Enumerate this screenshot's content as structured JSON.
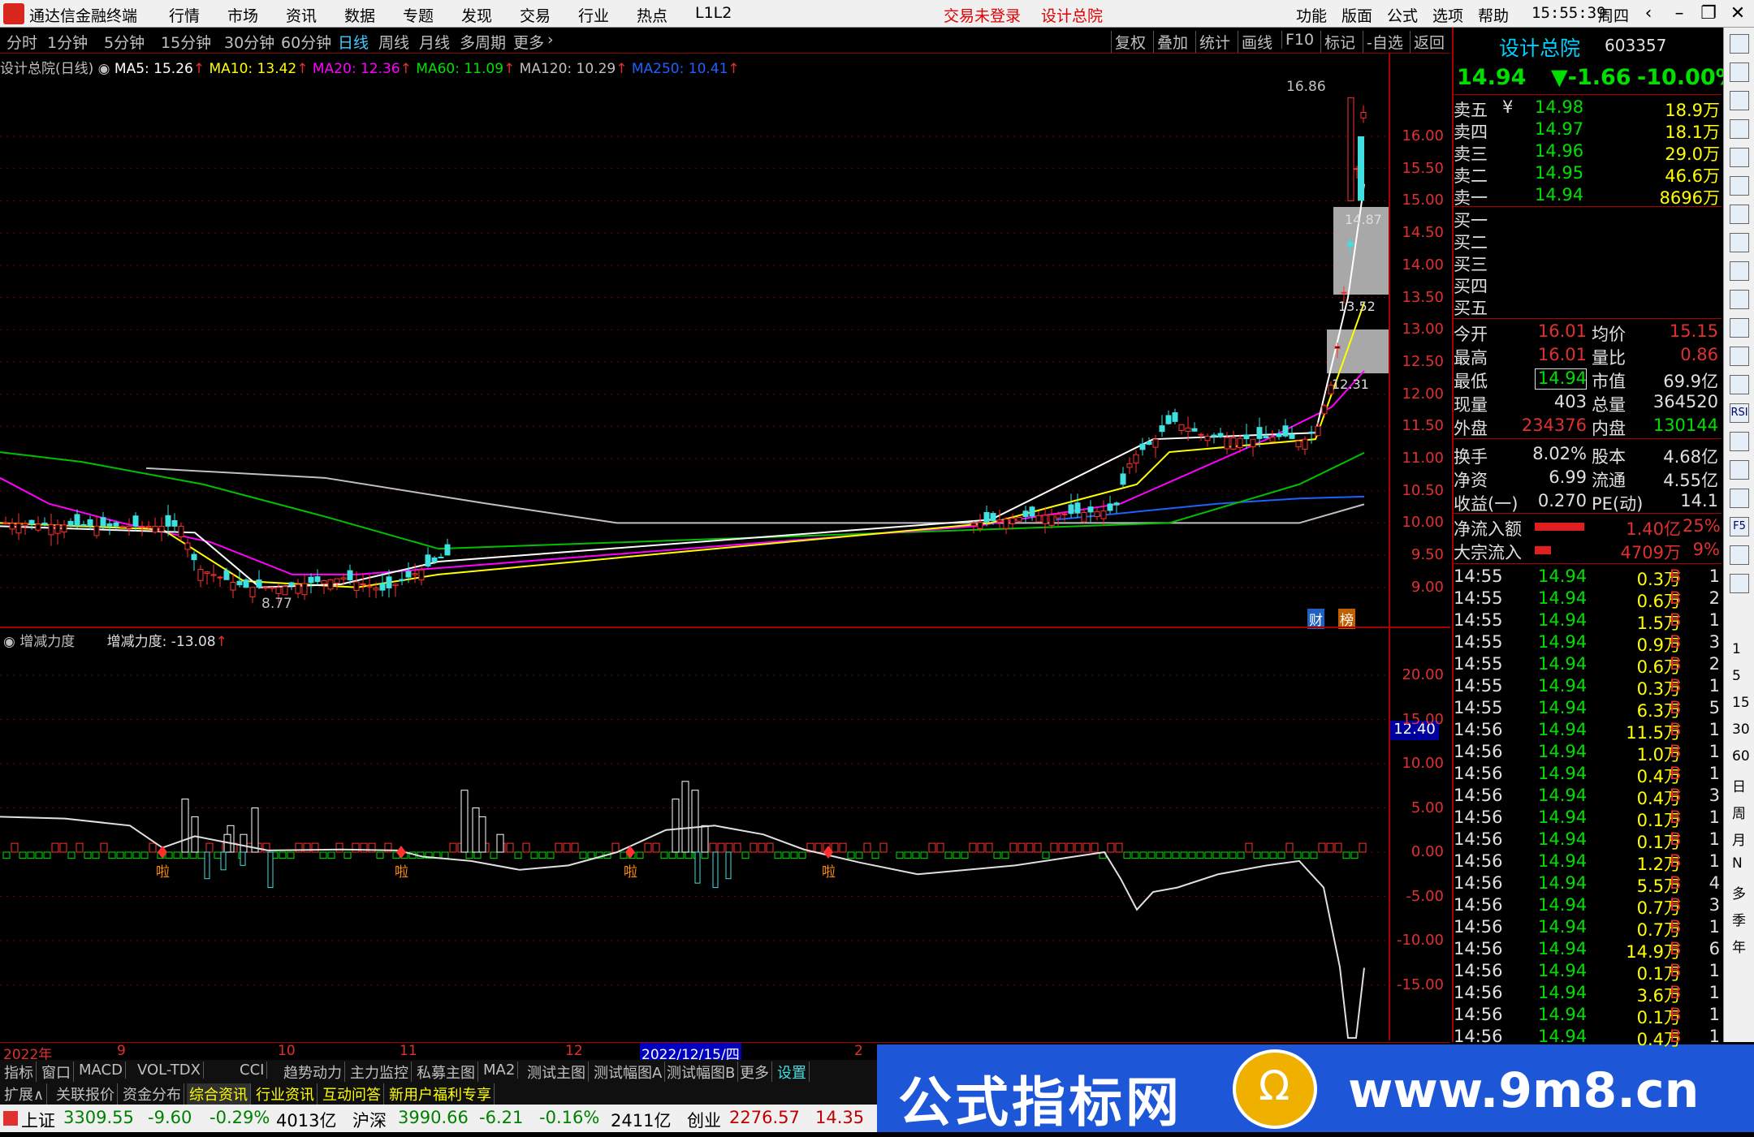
{
  "titlebar": {
    "app_title": "通达信金融终端",
    "menus": [
      "行情",
      "市场",
      "资讯",
      "数据",
      "专题",
      "发现",
      "交易",
      "行业",
      "热点",
      "L1L2"
    ],
    "trade_status": "交易未登录",
    "stock_name": "设计总院",
    "right_menus": [
      "功能",
      "版面",
      "公式",
      "选项",
      "帮助"
    ],
    "time": "15:55:39",
    "weekday": "周四"
  },
  "periods": [
    "分时",
    "1分钟",
    "5分钟",
    "15分钟",
    "30分钟",
    "60分钟",
    "日线",
    "周线",
    "月线",
    "多周期",
    "更多"
  ],
  "selected_period": "日线",
  "tools": [
    "复权",
    "叠加",
    "统计",
    "画线",
    "F10",
    "标记",
    "-自选",
    "返回"
  ],
  "main_chart": {
    "title": "设计总院(日线)",
    "ma": [
      {
        "label": "MA5: 15.26",
        "color": "#ffffff"
      },
      {
        "label": "MA10: 13.42",
        "color": "#ffff00"
      },
      {
        "label": "MA20: 12.36",
        "color": "#ff00ff"
      },
      {
        "label": "MA60: 11.09",
        "color": "#00e000"
      },
      {
        "label": "MA120: 10.29",
        "color": "#c0c0c0"
      },
      {
        "label": "MA250: 10.41",
        "color": "#2060ff"
      }
    ],
    "yticks": [
      "16.00",
      "15.50",
      "15.00",
      "14.50",
      "14.00",
      "13.50",
      "13.00",
      "12.50",
      "12.00",
      "11.50",
      "11.00",
      "10.50",
      "10.00",
      "9.50",
      "9.00"
    ],
    "high_label": "16.86",
    "low_label": "8.77",
    "box_labels": [
      "14.87",
      "13.52",
      "12.31"
    ],
    "badges": [
      "财",
      "榜"
    ]
  },
  "sub_chart": {
    "title": "增减力度",
    "value_label": "增减力度: -13.08",
    "yticks": [
      "20.00",
      "15.00",
      "10.00",
      "5.00",
      "0.00",
      "-5.00",
      "-10.00",
      "-15.00"
    ],
    "current_tag": "12.40",
    "marker_text": "啦"
  },
  "time_axis": [
    "2022年",
    "9",
    "10",
    "11",
    "12",
    "2022/12/15/四",
    "2"
  ],
  "quote": {
    "name": "设计总院",
    "code": "603357",
    "price": "14.94",
    "change": "▼-1.66",
    "change_pct": "-10.00%",
    "asks": [
      {
        "label": "卖五",
        "price": "14.98",
        "vol": "18.9万"
      },
      {
        "label": "卖四",
        "price": "14.97",
        "vol": "18.1万"
      },
      {
        "label": "卖三",
        "price": "14.96",
        "vol": "29.0万"
      },
      {
        "label": "卖二",
        "price": "14.95",
        "vol": "46.6万"
      },
      {
        "label": "卖一",
        "price": "14.94",
        "vol": "8696万"
      }
    ],
    "ask_extra": "¥",
    "bids": [
      "买一",
      "买二",
      "买三",
      "买四",
      "买五"
    ],
    "stats": [
      {
        "l1": "今开",
        "v1": "16.01",
        "l2": "均价",
        "v2": "15.15",
        "c1": "#e03030",
        "c2": "#e03030"
      },
      {
        "l1": "最高",
        "v1": "16.01",
        "l2": "量比",
        "v2": "0.86",
        "c1": "#e03030",
        "c2": "#e03030"
      },
      {
        "l1": "最低",
        "v1": "14.94",
        "l2": "市值",
        "v2": "69.9亿",
        "c1": "#00e000",
        "c2": "#e0e0e0"
      },
      {
        "l1": "现量",
        "v1": "403",
        "l2": "总量",
        "v2": "364520",
        "c1": "#e0e0e0",
        "c2": "#e0e0e0"
      },
      {
        "l1": "外盘",
        "v1": "234376",
        "l2": "内盘",
        "v2": "130144",
        "c1": "#e03030",
        "c2": "#00e000"
      },
      {
        "l1": "换手",
        "v1": "8.02%",
        "l2": "股本",
        "v2": "4.68亿",
        "c1": "#e0e0e0",
        "c2": "#e0e0e0"
      },
      {
        "l1": "净资",
        "v1": "6.99",
        "l2": "流通",
        "v2": "4.55亿",
        "c1": "#e0e0e0",
        "c2": "#e0e0e0"
      },
      {
        "l1": "收益(一)",
        "v1": "0.270",
        "l2": "PE(动)",
        "v2": "14.1",
        "c1": "#e0e0e0",
        "c2": "#e0e0e0"
      }
    ],
    "flows": [
      {
        "label": "净流入额",
        "value": "1.40亿",
        "pct": "25%",
        "bar": 0.9
      },
      {
        "label": "大宗流入",
        "value": "4709万",
        "pct": "9%",
        "bar": 0.3
      }
    ],
    "ticks": [
      {
        "t": "14:55",
        "p": "14.94",
        "v": "0.3万",
        "s": "B",
        "n": "1"
      },
      {
        "t": "14:55",
        "p": "14.94",
        "v": "0.6万",
        "s": "B",
        "n": "2"
      },
      {
        "t": "14:55",
        "p": "14.94",
        "v": "1.5万",
        "s": "B",
        "n": "1"
      },
      {
        "t": "14:55",
        "p": "14.94",
        "v": "0.9万",
        "s": "B",
        "n": "3"
      },
      {
        "t": "14:55",
        "p": "14.94",
        "v": "0.6万",
        "s": "B",
        "n": "2"
      },
      {
        "t": "14:55",
        "p": "14.94",
        "v": "0.3万",
        "s": "B",
        "n": "1"
      },
      {
        "t": "14:55",
        "p": "14.94",
        "v": "6.3万",
        "s": "B",
        "n": "5"
      },
      {
        "t": "14:56",
        "p": "14.94",
        "v": "11.5万",
        "s": "B",
        "n": "1"
      },
      {
        "t": "14:56",
        "p": "14.94",
        "v": "1.0万",
        "s": "B",
        "n": "1"
      },
      {
        "t": "14:56",
        "p": "14.94",
        "v": "0.4万",
        "s": "B",
        "n": "1"
      },
      {
        "t": "14:56",
        "p": "14.94",
        "v": "0.4万",
        "s": "B",
        "n": "3"
      },
      {
        "t": "14:56",
        "p": "14.94",
        "v": "0.1万",
        "s": "B",
        "n": "1"
      },
      {
        "t": "14:56",
        "p": "14.94",
        "v": "0.1万",
        "s": "B",
        "n": "1"
      },
      {
        "t": "14:56",
        "p": "14.94",
        "v": "1.2万",
        "s": "B",
        "n": "1"
      },
      {
        "t": "14:56",
        "p": "14.94",
        "v": "5.5万",
        "s": "B",
        "n": "4"
      },
      {
        "t": "14:56",
        "p": "14.94",
        "v": "0.7万",
        "s": "B",
        "n": "3"
      },
      {
        "t": "14:56",
        "p": "14.94",
        "v": "0.7万",
        "s": "B",
        "n": "1"
      },
      {
        "t": "14:56",
        "p": "14.94",
        "v": "14.9万",
        "s": "B",
        "n": "6"
      },
      {
        "t": "14:56",
        "p": "14.94",
        "v": "0.1万",
        "s": "B",
        "n": "1"
      },
      {
        "t": "14:56",
        "p": "14.94",
        "v": "3.6万",
        "s": "B",
        "n": "1"
      },
      {
        "t": "14:56",
        "p": "14.94",
        "v": "0.1万",
        "s": "B",
        "n": "1"
      },
      {
        "t": "14:56",
        "p": "14.94",
        "v": "0.4万",
        "s": "B",
        "n": "1"
      }
    ]
  },
  "sidebar_labels": [
    "1",
    "5",
    "15",
    "30",
    "60",
    "日",
    "周",
    "月",
    "N",
    "多",
    "季",
    "年"
  ],
  "sidebar_icons": [
    "RSI",
    "Fn",
    "F6",
    "F10",
    "F2",
    "F5"
  ],
  "indicator_tabs": [
    "指标",
    "窗口",
    "MACD",
    "VOL-TDX",
    "CCI",
    "趋势动力",
    "主力监控",
    "私募主图",
    "MA2",
    "测试主图",
    "测试幅图A",
    "测试幅图B",
    "更多",
    "设置"
  ],
  "extra_tabs": [
    "扩展∧",
    "关联报价",
    "资金分布",
    "综合资讯",
    "行业资讯",
    "互动问答",
    "新用户福利专享"
  ],
  "indices": [
    {
      "name": "上证",
      "value": "3309.55",
      "chg": "-9.60",
      "pct": "-0.29%",
      "amt": "4013亿"
    },
    {
      "name": "沪深",
      "value": "3990.66",
      "chg": "-6.21",
      "pct": "-0.16%",
      "amt": "2411亿"
    },
    {
      "name": "创业",
      "value": "2276.57",
      "chg": "14.35"
    }
  ],
  "banner": {
    "title": "公式指标网",
    "url": "www.9m8.cn",
    "seal_text": "Ω"
  }
}
